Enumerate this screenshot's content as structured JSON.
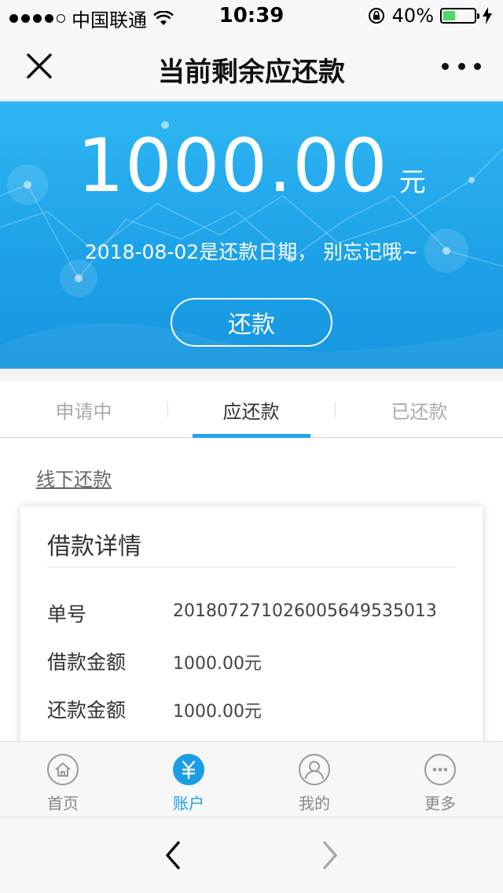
{
  "status_bar": {
    "carrier": "中国联通",
    "time": "10:39",
    "battery": "40%"
  },
  "nav": {
    "title": "当前剩余应还款"
  },
  "hero": {
    "amount": "1000.00",
    "unit": "元",
    "due_text": "2018-08-02是还款日期， 别忘记哦~",
    "repay_button": "还款"
  },
  "tabs": [
    {
      "label": "申请中"
    },
    {
      "label": "应还款"
    },
    {
      "label": "已还款"
    }
  ],
  "offline_link": "线下还款",
  "card": {
    "title": "借款详情",
    "rows": [
      {
        "label": "单号",
        "value": "2018072710260056495350​13"
      },
      {
        "label": "借款金额",
        "value": "1000.00元"
      },
      {
        "label": "还款金额",
        "value": "1000.00元"
      }
    ]
  },
  "tabbar": [
    {
      "label": "首页",
      "icon": "home-icon"
    },
    {
      "label": "账户",
      "icon": "yuan-icon"
    },
    {
      "label": "我的",
      "icon": "user-icon"
    },
    {
      "label": "更多",
      "icon": "more-icon"
    }
  ],
  "colors": {
    "accent": "#1a9ee6",
    "hero_top": "#2fb6f3",
    "hero_bottom": "#1796e0"
  }
}
